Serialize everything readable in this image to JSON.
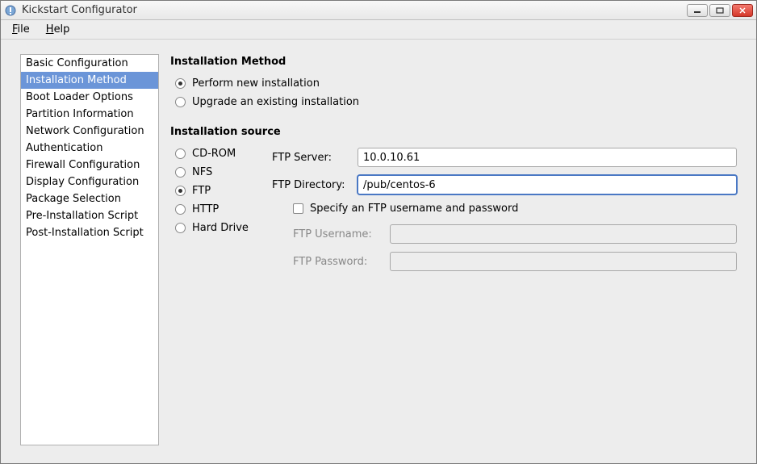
{
  "window": {
    "title": "Kickstart Configurator"
  },
  "menubar": {
    "file": "File",
    "help": "Help"
  },
  "sidebar": {
    "items": [
      {
        "label": "Basic Configuration"
      },
      {
        "label": "Installation Method"
      },
      {
        "label": "Boot Loader Options"
      },
      {
        "label": "Partition Information"
      },
      {
        "label": "Network Configuration"
      },
      {
        "label": "Authentication"
      },
      {
        "label": "Firewall Configuration"
      },
      {
        "label": "Display Configuration"
      },
      {
        "label": "Package Selection"
      },
      {
        "label": "Pre-Installation Script"
      },
      {
        "label": "Post-Installation Script"
      }
    ],
    "selected_index": 1
  },
  "main": {
    "method_heading": "Installation Method",
    "method_options": {
      "new_install": "Perform new installation",
      "upgrade": "Upgrade an existing installation"
    },
    "method_selected": "new_install",
    "source_heading": "Installation source",
    "source_options": {
      "cdrom": "CD-ROM",
      "nfs": "NFS",
      "ftp": "FTP",
      "http": "HTTP",
      "hd": "Hard Drive"
    },
    "source_selected": "ftp",
    "ftp": {
      "server_label": "FTP Server:",
      "server_value": "10.0.10.61",
      "dir_label": "FTP Directory:",
      "dir_value": "/pub/centos-6",
      "specify_label": "Specify an FTP username and password",
      "specify_checked": false,
      "username_label": "FTP Username:",
      "username_value": "",
      "password_label": "FTP Password:",
      "password_value": ""
    }
  }
}
